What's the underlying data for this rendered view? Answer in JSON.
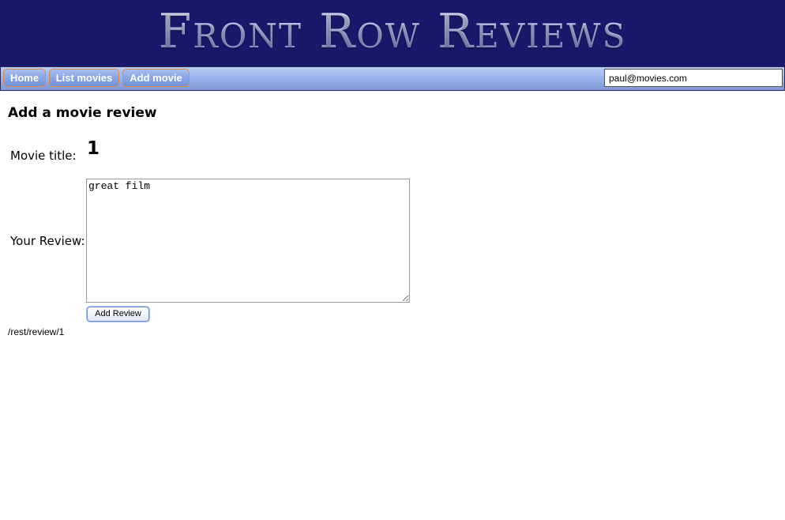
{
  "header": {
    "site_title": "Front Row Reviews"
  },
  "nav": {
    "home_label": "Home",
    "list_label": "List movies",
    "add_label": "Add movie",
    "user_email": "paul@movies.com"
  },
  "colors": {
    "banner": "#19196b",
    "nav_button_border": "#e08a4a",
    "nav_bar": "#98b2ea"
  },
  "form": {
    "heading": "Add a movie review",
    "title_label": "Movie title:",
    "title_value": "1",
    "review_label": "Your Review:",
    "review_value": "great film",
    "submit_label": "Add Review"
  },
  "footer": {
    "rest_path": "/rest/review/1"
  }
}
